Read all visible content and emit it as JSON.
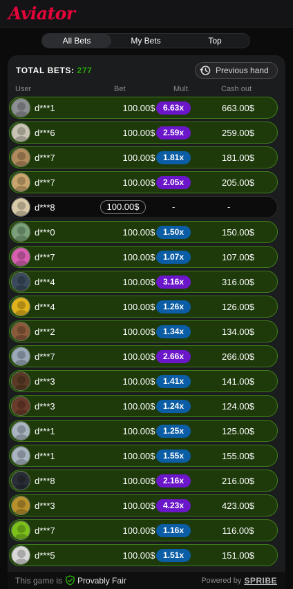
{
  "app": {
    "logo_text": "Aviator",
    "brand_color": "#e50539"
  },
  "tabs": [
    {
      "label": "All Bets",
      "active": true
    },
    {
      "label": "My Bets",
      "active": false
    },
    {
      "label": "Top",
      "active": false
    }
  ],
  "summary": {
    "total_label": "TOTAL BETS:",
    "total_value": "277",
    "total_value_color": "#28a909"
  },
  "previous_hand": {
    "label": "Previous hand",
    "icon": "history-clock-icon"
  },
  "columns": {
    "user": "User",
    "bet": "Bet",
    "mult": "Mult.",
    "cashout": "Cash out"
  },
  "colors": {
    "row_win_bg": "#1e3a0b",
    "row_win_border": "#3f7d1a",
    "mult_purple": "#6b17c9",
    "mult_blue": "#0b5da6"
  },
  "bets": [
    {
      "user": "d***1",
      "bet": "100.00$",
      "mult": "6.63x",
      "mult_color": "#6b17c9",
      "cashout": "663.00$",
      "avatar_color": "#8c8f92",
      "status": "won"
    },
    {
      "user": "d***6",
      "bet": "100.00$",
      "mult": "2.59x",
      "mult_color": "#6b17c9",
      "cashout": "259.00$",
      "avatar_color": "#c9c3b4",
      "status": "won"
    },
    {
      "user": "d***7",
      "bet": "100.00$",
      "mult": "1.81x",
      "mult_color": "#0b5da6",
      "cashout": "181.00$",
      "avatar_color": "#b08a5c",
      "status": "won"
    },
    {
      "user": "d***7",
      "bet": "100.00$",
      "mult": "2.05x",
      "mult_color": "#6b17c9",
      "cashout": "205.00$",
      "avatar_color": "#c9a46c",
      "status": "won"
    },
    {
      "user": "d***8",
      "bet": "100.00$",
      "mult": "-",
      "mult_color": "",
      "cashout": "-",
      "avatar_color": "#d8c9a8",
      "status": "active"
    },
    {
      "user": "d***0",
      "bet": "100.00$",
      "mult": "1.50x",
      "mult_color": "#0b5da6",
      "cashout": "150.00$",
      "avatar_color": "#7aa07a",
      "status": "won"
    },
    {
      "user": "d***7",
      "bet": "100.00$",
      "mult": "1.07x",
      "mult_color": "#0b5da6",
      "cashout": "107.00$",
      "avatar_color": "#d85fb0",
      "status": "won"
    },
    {
      "user": "d***4",
      "bet": "100.00$",
      "mult": "3.16x",
      "mult_color": "#6b17c9",
      "cashout": "316.00$",
      "avatar_color": "#3a4a5c",
      "status": "won"
    },
    {
      "user": "d***4",
      "bet": "100.00$",
      "mult": "1.26x",
      "mult_color": "#0b5da6",
      "cashout": "126.00$",
      "avatar_color": "#e0b21c",
      "status": "won"
    },
    {
      "user": "d***2",
      "bet": "100.00$",
      "mult": "1.34x",
      "mult_color": "#0b5da6",
      "cashout": "134.00$",
      "avatar_color": "#8a5a3a",
      "status": "won"
    },
    {
      "user": "d***7",
      "bet": "100.00$",
      "mult": "2.66x",
      "mult_color": "#6b17c9",
      "cashout": "266.00$",
      "avatar_color": "#9aa8b8",
      "status": "won"
    },
    {
      "user": "d***3",
      "bet": "100.00$",
      "mult": "1.41x",
      "mult_color": "#0b5da6",
      "cashout": "141.00$",
      "avatar_color": "#5a3a24",
      "status": "won"
    },
    {
      "user": "d***3",
      "bet": "100.00$",
      "mult": "1.24x",
      "mult_color": "#0b5da6",
      "cashout": "124.00$",
      "avatar_color": "#6a3a2a",
      "status": "won"
    },
    {
      "user": "d***1",
      "bet": "100.00$",
      "mult": "1.25x",
      "mult_color": "#0b5da6",
      "cashout": "125.00$",
      "avatar_color": "#a8b4c0",
      "status": "won"
    },
    {
      "user": "d***1",
      "bet": "100.00$",
      "mult": "1.55x",
      "mult_color": "#0b5da6",
      "cashout": "155.00$",
      "avatar_color": "#a8b4c0",
      "status": "won"
    },
    {
      "user": "d***8",
      "bet": "100.00$",
      "mult": "2.16x",
      "mult_color": "#6b17c9",
      "cashout": "216.00$",
      "avatar_color": "#2a2e36",
      "status": "won"
    },
    {
      "user": "d***3",
      "bet": "100.00$",
      "mult": "4.23x",
      "mult_color": "#6b17c9",
      "cashout": "423.00$",
      "avatar_color": "#b8902c",
      "status": "won"
    },
    {
      "user": "d***7",
      "bet": "100.00$",
      "mult": "1.16x",
      "mult_color": "#0b5da6",
      "cashout": "116.00$",
      "avatar_color": "#7cc01c",
      "status": "won"
    },
    {
      "user": "d***5",
      "bet": "100.00$",
      "mult": "1.51x",
      "mult_color": "#0b5da6",
      "cashout": "151.00$",
      "avatar_color": "#d8d8d8",
      "status": "won"
    }
  ],
  "footer": {
    "fair_prefix": "This game is",
    "fair_label": "Provably Fair",
    "powered_label": "Powered by",
    "provider": "SPRIBE"
  }
}
